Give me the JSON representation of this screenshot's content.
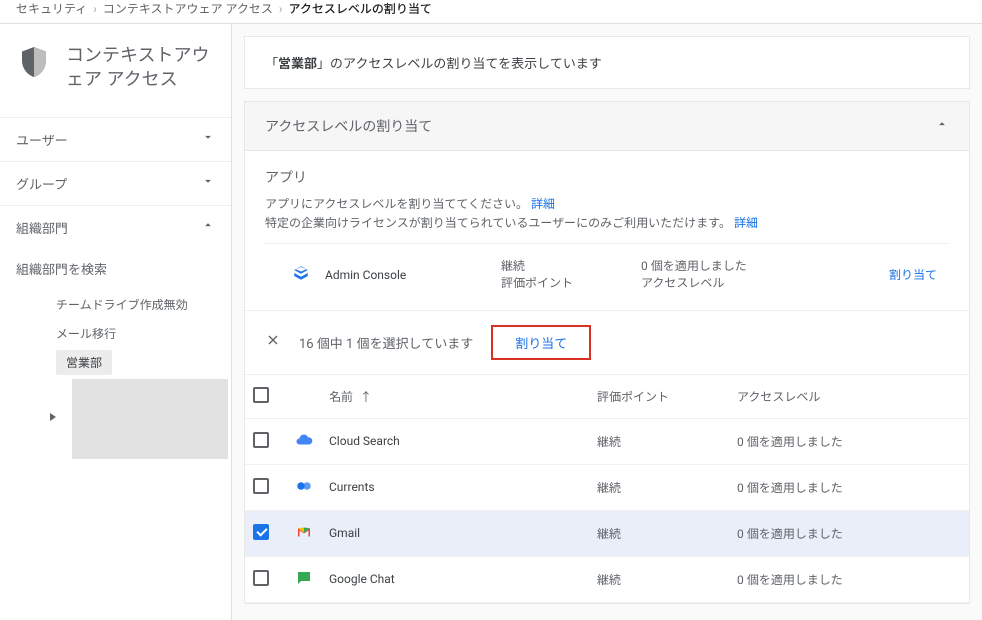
{
  "breadcrumb": {
    "items": [
      {
        "label": "セキュリティ"
      },
      {
        "label": "コンテキストアウェア アクセス"
      },
      {
        "label": "アクセスレベルの割り当て"
      }
    ]
  },
  "sidebar": {
    "title": "コンテキストアウェア アクセス",
    "items": [
      {
        "label": "ユーザー",
        "expanded": false
      },
      {
        "label": "グループ",
        "expanded": false
      },
      {
        "label": "組織部門",
        "expanded": true
      }
    ],
    "search_label": "組織部門を検索",
    "tree": [
      {
        "label": "チームドライブ作成無効",
        "selected": false
      },
      {
        "label": "メール移行",
        "selected": false
      },
      {
        "label": "営業部",
        "selected": true
      }
    ]
  },
  "banner": {
    "prefix": "「",
    "org": "営業部",
    "suffix": "」のアクセスレベルの割り当てを表示しています"
  },
  "panel": {
    "title": "アクセスレベルの割り当て",
    "apps_section": "アプリ",
    "desc1_text": "アプリにアクセスレベルを割り当ててください。",
    "desc1_link": "詳細",
    "desc2_text": "特定の企業向けライセンスが割り当てられているユーザーにのみご利用いただけます。",
    "desc2_link": "詳細",
    "info_row": {
      "name": "Admin Console",
      "eval_line1": "継続",
      "eval_line2": "評価ポイント",
      "acc_line1": "0 個を適用しました",
      "acc_line2": "アクセスレベル",
      "assign": "割り当て"
    },
    "selection_bar": {
      "text": "16 個中 1 個を選択しています",
      "button": "割り当て"
    },
    "table": {
      "headers": {
        "name": "名前",
        "eval": "評価ポイント",
        "access": "アクセスレベル"
      },
      "rows": [
        {
          "name": "Cloud Search",
          "icon": "cloud-search",
          "eval": "継続",
          "access": "0 個を適用しました",
          "checked": false
        },
        {
          "name": "Currents",
          "icon": "currents",
          "eval": "継続",
          "access": "0 個を適用しました",
          "checked": false
        },
        {
          "name": "Gmail",
          "icon": "gmail",
          "eval": "継続",
          "access": "0 個を適用しました",
          "checked": true
        },
        {
          "name": "Google Chat",
          "icon": "google-chat",
          "eval": "継続",
          "access": "0 個を適用しました",
          "checked": false
        }
      ]
    }
  }
}
